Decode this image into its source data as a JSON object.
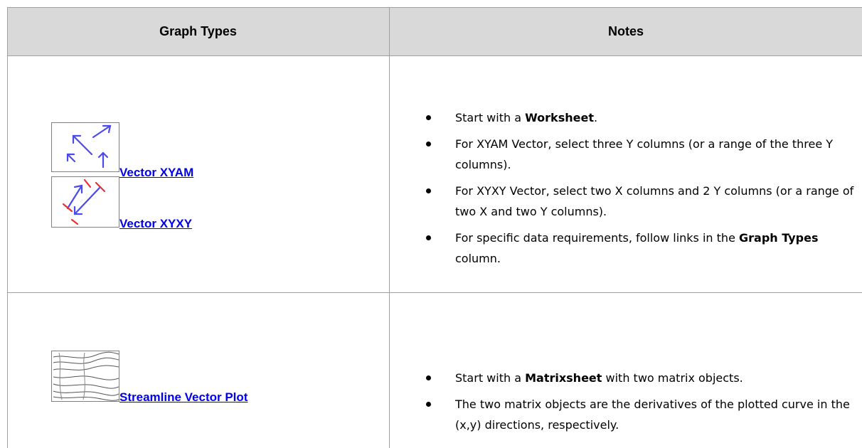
{
  "header": {
    "col1": "Graph Types",
    "col2": "Notes"
  },
  "rows": [
    {
      "links": [
        "Vector XYAM",
        "Vector XYXY"
      ],
      "notes": {
        "n1_pre": "Start with a ",
        "n1_bold": "Worksheet",
        "n1_post": ".",
        "n2": "For XYAM Vector, select three Y columns (or a range of the three Y columns).",
        "n3": "For XYXY Vector, select two X columns and 2 Y columns (or a range of two X and two Y columns).",
        "n4_pre": "For specific data requirements, follow links in the ",
        "n4_bold": "Graph Types",
        "n4_post": " column."
      }
    },
    {
      "links": [
        "Streamline Vector Plot"
      ],
      "notes": {
        "n1_pre": "Start with a ",
        "n1_bold": "Matrixsheet",
        "n1_post": " with two matrix objects.",
        "n2": "The two matrix objects are the derivatives of the plotted curve in the (x,y) directions, respectively."
      }
    }
  ],
  "colors": {
    "header_bg": "#d9d9d9",
    "border": "#a0a0a0",
    "link": "#0000ee",
    "arrow_blue": "#4a4af0",
    "arrow_red": "#e83030"
  },
  "icons": [
    "vector-xyam-icon",
    "vector-xyxy-icon",
    "streamline-icon"
  ]
}
